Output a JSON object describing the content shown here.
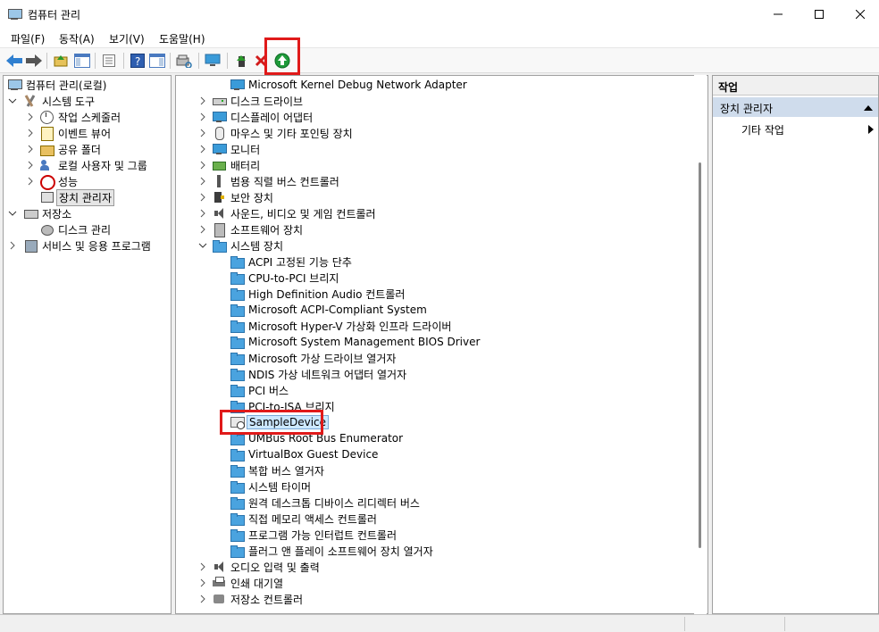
{
  "window": {
    "title": "컴퓨터 관리"
  },
  "menu": [
    "파일(F)",
    "동작(A)",
    "보기(V)",
    "도움말(H)"
  ],
  "tree": {
    "root": "컴퓨터 관리(로컬)",
    "system_tools": "시스템 도구",
    "task_scheduler": "작업 스케줄러",
    "event_viewer": "이벤트 뷰어",
    "shared_folders": "공유 폴더",
    "local_users": "로컬 사용자 및 그룹",
    "performance": "성능",
    "device_manager": "장치 관리자",
    "storage": "저장소",
    "disk_management": "디스크 관리",
    "services_apps": "서비스 및 응용 프로그램"
  },
  "devices": {
    "top_partial": "Microsoft Kernel Debug Network Adapter",
    "disk_drives": "디스크 드라이브",
    "display_adapters": "디스플레이 어댑터",
    "mice": "마우스 및 기타 포인팅 장치",
    "monitors": "모니터",
    "batteries": "배터리",
    "usb": "범용 직렬 버스 컨트롤러",
    "security": "보안 장치",
    "sound": "사운드, 비디오 및 게임 컨트롤러",
    "software": "소프트웨어 장치",
    "system": "시스템 장치",
    "system_children": [
      "ACPI 고정된 기능 단추",
      "CPU-to-PCI 브리지",
      "High Definition Audio 컨트롤러",
      "Microsoft ACPI-Compliant System",
      "Microsoft Hyper-V 가상화 인프라 드라이버",
      "Microsoft System Management BIOS Driver",
      "Microsoft 가상 드라이브 열거자",
      "NDIS 가상 네트워크 어댑터 열거자",
      "PCI 버스",
      "PCI-to-ISA 브리지",
      "SampleDevice",
      "UMBus Root Bus Enumerator",
      "VirtualBox Guest Device",
      "복합 버스 열거자",
      "시스템 타이머",
      "원격 데스크톱 디바이스 리디렉터 버스",
      "직접 메모리 액세스 컨트롤러",
      "프로그램 가능 인터럽트 컨트롤러",
      "플러그 앤 플레이 소프트웨어 장치 열거자"
    ],
    "audio_io": "오디오 입력 및 출력",
    "print_queues": "인쇄 대기열",
    "storage_controllers": "저장소 컨트롤러"
  },
  "actions": {
    "header": "작업",
    "section": "장치 관리자",
    "more": "기타 작업"
  },
  "colors": {
    "highlight": "#e01a1a",
    "selection": "#cce8ff",
    "actions_section": "#cfdcec"
  }
}
